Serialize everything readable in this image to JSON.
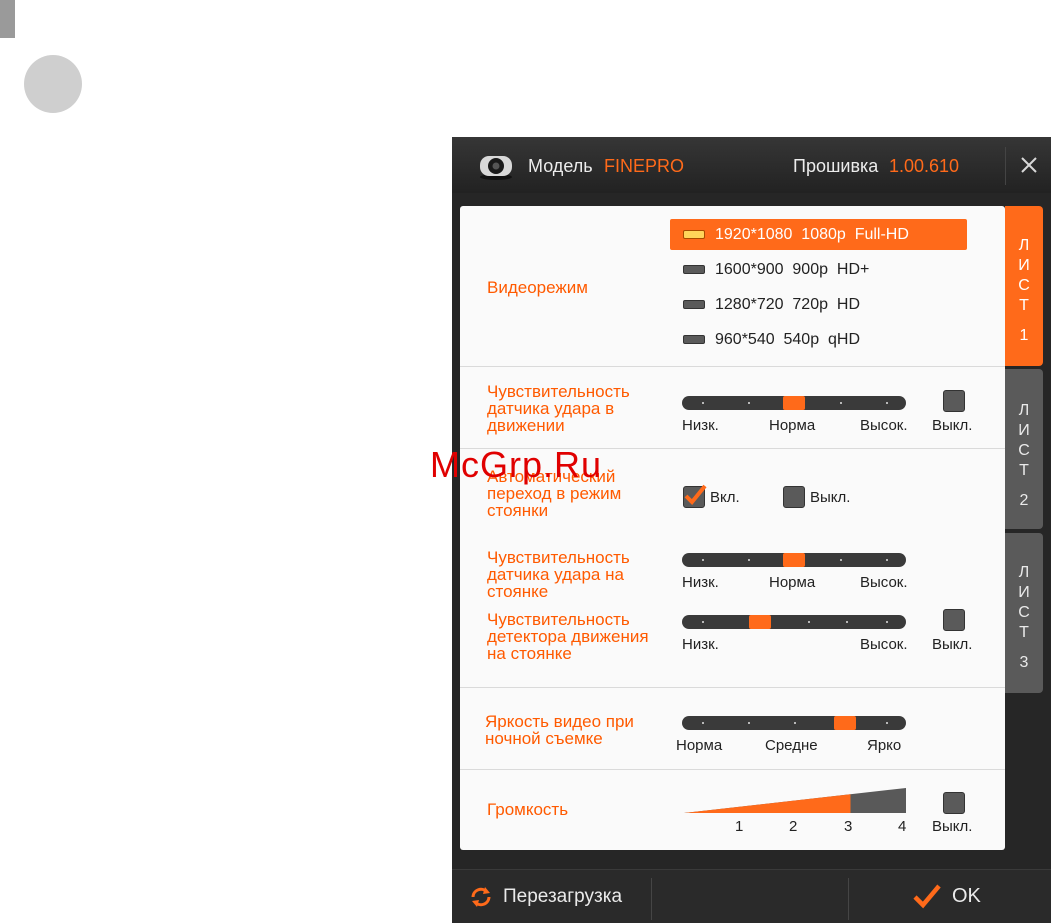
{
  "header": {
    "model_label": "Модель",
    "model_value": "FINEPRO",
    "firmware_label": "Прошивка",
    "firmware_value": "1.00.610",
    "close_icon": "close-icon"
  },
  "colors": {
    "accent": "#ff6a1a",
    "panel": "#fafafa",
    "frame": "#262626"
  },
  "video_mode": {
    "label": "Видеорежим",
    "options": [
      {
        "label": "1920*1080  1080p  Full-HD",
        "selected": true
      },
      {
        "label": "1600*900  900p  HD+",
        "selected": false
      },
      {
        "label": "1280*720  720p  HD",
        "selected": false
      },
      {
        "label": "960*540  540p  qHD",
        "selected": false
      }
    ]
  },
  "shock_driving": {
    "label": [
      "Чувствительность",
      "датчика удара в",
      "движении"
    ],
    "ticks": [
      "Низк.",
      "Норма",
      "Высок."
    ],
    "level": 0.5,
    "off_label": "Выкл."
  },
  "auto_parking": {
    "label": [
      "Автоматический",
      "переход в режим",
      "стоянки"
    ],
    "on_label": "Вкл.",
    "off_label": "Выкл.",
    "on_checked": true
  },
  "shock_parking": {
    "label": [
      "Чувствительность",
      "датчика удара на",
      "стоянке"
    ],
    "ticks": [
      "Низк.",
      "Норма",
      "Высок."
    ],
    "level": 0.5
  },
  "motion_parking": {
    "label": [
      "Чувствительность",
      "детектора движения",
      "на стоянке"
    ],
    "ticks": [
      "Низк.",
      "Высок."
    ],
    "level": 0.33,
    "off_label": "Выкл."
  },
  "night_brightness": {
    "label": [
      "Яркость видео при",
      "ночной съемке"
    ],
    "ticks": [
      "Норма",
      "Средне",
      "Ярко"
    ],
    "level": 0.75
  },
  "volume": {
    "label": "Громкость",
    "levels": [
      "1",
      "2",
      "3",
      "4"
    ],
    "level": 3,
    "off_label": "Выкл."
  },
  "tabs": [
    {
      "chars": [
        "Л",
        "И",
        "С",
        "Т",
        "1"
      ],
      "active": true
    },
    {
      "chars": [
        "Л",
        "И",
        "С",
        "Т",
        "2"
      ],
      "active": false
    },
    {
      "chars": [
        "Л",
        "И",
        "С",
        "Т",
        "3"
      ],
      "active": false
    }
  ],
  "footer": {
    "reboot_label": "Перезагрузка",
    "ok_label": "OK"
  },
  "watermark": "McGrp.Ru"
}
